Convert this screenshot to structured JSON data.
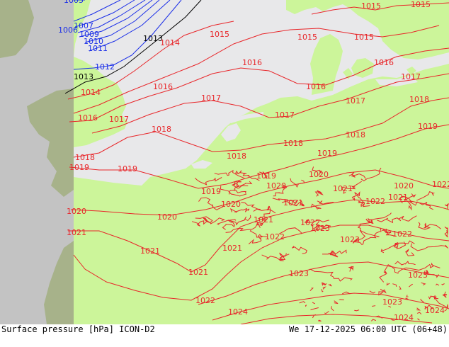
{
  "footer": {
    "left": "Surface pressure [hPa] ICON-D2",
    "right": "We 17-12-2025 06:00 UTC (06+48)"
  },
  "colors": {
    "land": "#ccf59a",
    "sea": "#e8e8ea",
    "outside_domain": "#c3c3c3",
    "outside_land": "#a7b28a",
    "isobar_red": "#e8262a",
    "isobar_blue": "#1a2ee8",
    "isobar_black": "#000000"
  },
  "isobar_labels": {
    "blue": [
      "1005",
      "1006",
      "1007",
      "1009",
      "1010",
      "1011",
      "1012"
    ],
    "black": [
      "1013",
      "1013"
    ],
    "red": [
      "1014",
      "1014",
      "1015",
      "1015",
      "1015",
      "1015",
      "1015",
      "1016",
      "1016",
      "1016",
      "1016",
      "1016",
      "1017",
      "1017",
      "1017",
      "1017",
      "1017",
      "1018",
      "1018",
      "1018",
      "1018",
      "1018",
      "1018",
      "1019",
      "1019",
      "1019",
      "1019",
      "1019",
      "1019",
      "1020",
      "1020",
      "1020",
      "1020",
      "1020",
      "1020",
      "1021",
      "1021",
      "1021",
      "1021",
      "1021",
      "1021",
      "1021",
      "1021",
      "1022",
      "1022",
      "1022",
      "1022",
      "1022",
      "1022",
      "1023",
      "1023",
      "1023",
      "1023",
      "1023",
      "1024",
      "1024",
      "1024"
    ]
  }
}
